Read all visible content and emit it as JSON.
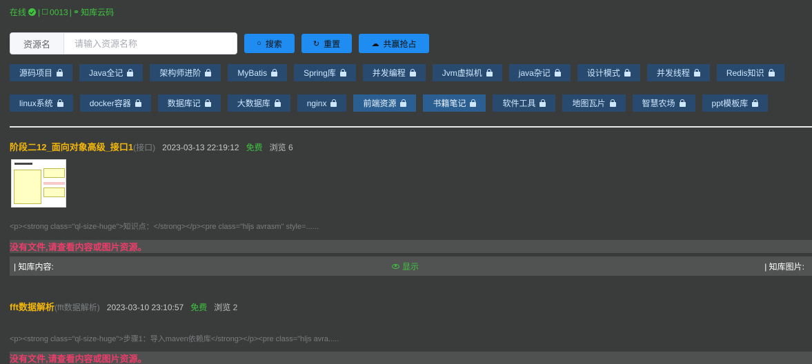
{
  "status": {
    "online_label": "在线",
    "separator": "|",
    "id_label": "0013",
    "site_label": "知库云码"
  },
  "search": {
    "prefix_label": "资源名",
    "placeholder": "请输入资源名称",
    "search_label": "搜索",
    "reset_label": "重置",
    "share_label": "共赢抢占"
  },
  "categories_row1": [
    {
      "label": "源码项目"
    },
    {
      "label": "Java全记"
    },
    {
      "label": "架构师进阶"
    },
    {
      "label": "MyBatis"
    },
    {
      "label": "Spring库"
    },
    {
      "label": "并发编程"
    },
    {
      "label": "Jvm虚拟机"
    },
    {
      "label": "java杂记"
    },
    {
      "label": "设计模式"
    },
    {
      "label": "并发线程"
    },
    {
      "label": "Redis知识"
    }
  ],
  "categories_row2": [
    {
      "label": "linux系统"
    },
    {
      "label": "docker容器"
    },
    {
      "label": "数据库记"
    },
    {
      "label": "大数据库"
    },
    {
      "label": "nginx"
    },
    {
      "label": "前端资源"
    },
    {
      "label": "书籍笔记"
    },
    {
      "label": "软件工具"
    },
    {
      "label": "地图瓦片"
    },
    {
      "label": "智慧农场"
    },
    {
      "label": "ppt模板库"
    }
  ],
  "posts": [
    {
      "title": "阶段二12_面向对象高级_接口1",
      "tag": "(接口)",
      "date": "2023-03-13 22:19:12",
      "price": "免费",
      "views": "浏览 6",
      "snippet": "<p><strong class=\"ql-size-huge\">知识点：</strong></p><pre class=\"hljs avrasm\" style=......",
      "no_file": "没有文件,请查看内容或图片资源。",
      "content_label": "| 知库内容:",
      "show_label": "显示",
      "image_label": "| 知库图片:"
    },
    {
      "title": "fft数据解析",
      "tag": "(fft数据解析)",
      "date": "2023-03-10 23:10:57",
      "price": "免费",
      "views": "浏览 2",
      "snippet": "<p><strong class=\"ql-size-huge\">步骤1：导入maven依赖库</strong></p><pre class=\"hljs avra.....",
      "no_file": "没有文件,请查看内容或图片资源。"
    }
  ]
}
